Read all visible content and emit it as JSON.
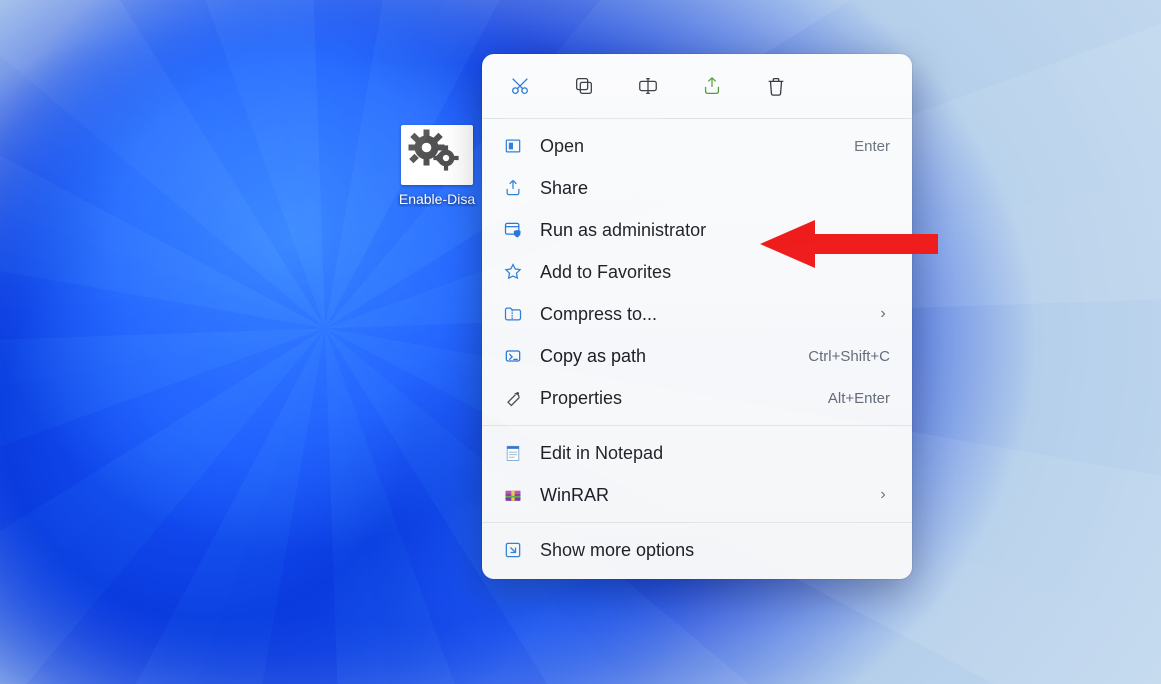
{
  "desktop_icon": {
    "label": "Enable-Disa"
  },
  "toolbar": {
    "cut": "Cut",
    "copy": "Copy",
    "rename": "Rename",
    "share_tool": "Share",
    "delete": "Delete"
  },
  "menu": {
    "open": {
      "label": "Open",
      "hint": "Enter"
    },
    "share": {
      "label": "Share"
    },
    "run_admin": {
      "label": "Run as administrator"
    },
    "favorites": {
      "label": "Add to Favorites"
    },
    "compress": {
      "label": "Compress to...",
      "submenu": true
    },
    "copy_path": {
      "label": "Copy as path",
      "hint": "Ctrl+Shift+C"
    },
    "properties": {
      "label": "Properties",
      "hint": "Alt+Enter"
    },
    "notepad": {
      "label": "Edit in Notepad"
    },
    "winrar": {
      "label": "WinRAR",
      "submenu": true
    },
    "more": {
      "label": "Show more options"
    }
  }
}
